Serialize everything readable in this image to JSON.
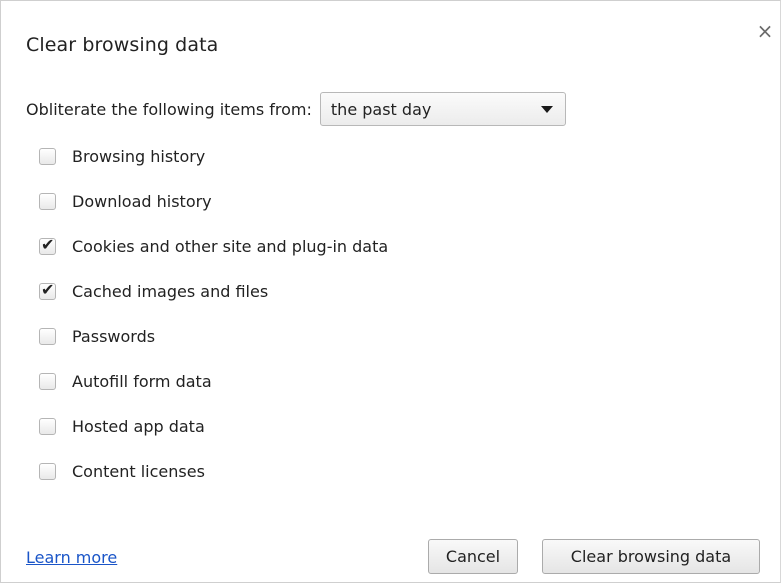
{
  "dialog": {
    "title": "Clear browsing data",
    "close_glyph": "×",
    "close_icon": "close-icon"
  },
  "obliterate": {
    "label": "Obliterate the following items from:",
    "selected": "the past day",
    "arrow_icon": "triangle-down-icon"
  },
  "options": [
    {
      "label": "Browsing history",
      "checked": false
    },
    {
      "label": "Download history",
      "checked": false
    },
    {
      "label": "Cookies and other site and plug-in data",
      "checked": true
    },
    {
      "label": "Cached images and files",
      "checked": true
    },
    {
      "label": "Passwords",
      "checked": false
    },
    {
      "label": "Autofill form data",
      "checked": false
    },
    {
      "label": "Hosted app data",
      "checked": false
    },
    {
      "label": "Content licenses",
      "checked": false
    }
  ],
  "footer": {
    "learn_more": "Learn more",
    "cancel": "Cancel",
    "clear": "Clear browsing data"
  },
  "colors": {
    "link": "#1a55c8",
    "text": "#222222",
    "border": "#b5b5b5"
  }
}
